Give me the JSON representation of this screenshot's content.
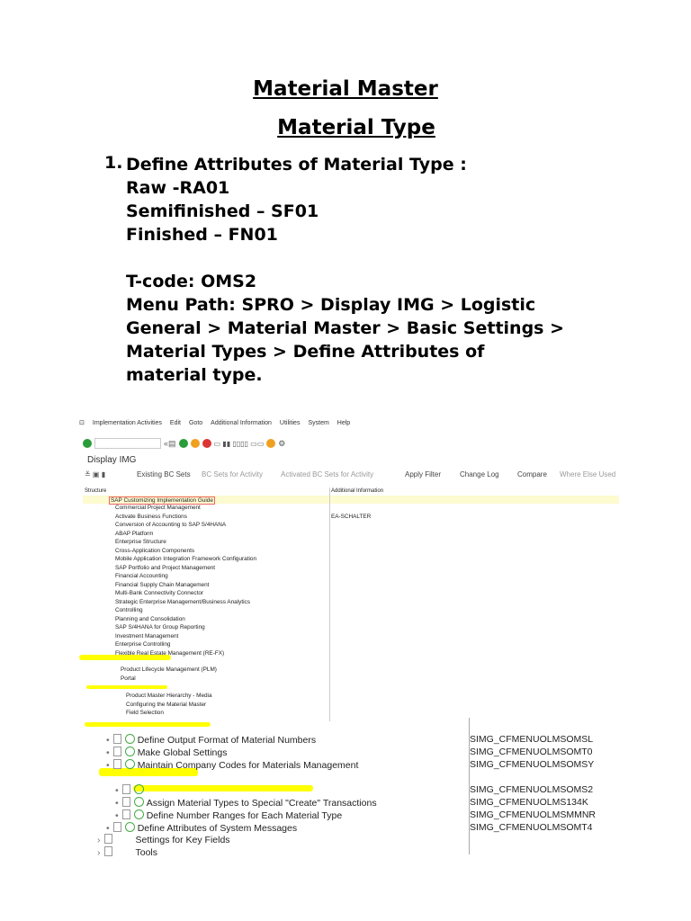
{
  "doc": {
    "title": "Material Master",
    "subtitle": "Material Type",
    "item_number": "1.",
    "lines": [
      "Define Attributes of Material Type :",
      "Raw -RA01",
      "Semifinished – SF01",
      "Finished – FN01",
      "",
      "T-code: OMS2",
      "Menu Path:  SPRO > Display IMG > Logistic",
      "General > Material Master > Basic Settings >",
      "Material Types > Define Attributes of",
      "material type."
    ]
  },
  "sap": {
    "menu": [
      "Implementation Activities",
      "Edit",
      "Goto",
      "Additional Information",
      "Utilities",
      "System",
      "Help"
    ],
    "screen_title": "Display IMG",
    "app_toolbar": [
      "Existing BC Sets",
      "BC Sets for Activity",
      "Activated BC Sets for Activity",
      "Apply Filter",
      "Change Log",
      "Compare",
      "Where Else Used"
    ],
    "columns": [
      "Structure",
      "Additional Information"
    ],
    "root": "SAP Customizing Implementation Guide",
    "tree": [
      "Commercial Project Management",
      "Activate Business Functions",
      "Conversion of Accounting to SAP S/4HANA",
      "ABAP Platform",
      "Enterprise Structure",
      "Cross-Application Components",
      "Mobile Application Integration Framework Configuration",
      "SAP Portfolio and Project Management",
      "Financial Accounting",
      "Financial Supply Chain Management",
      "Multi-Bank Connectivity Connector",
      "Strategic Enterprise Management/Business Analytics",
      "Controlling",
      "Planning and Consolidation",
      "SAP S/4HANA for Group Reporting",
      "Investment Management",
      "Enterprise Controlling",
      "Flexible Real Estate Management (RE-FX)"
    ],
    "tree_info": {
      "1": "EA-SCHALTER"
    },
    "sub1": [
      "Product Lifecycle Management (PLM)",
      "Portal"
    ],
    "sub2": [
      "Product Master Hierarchy - Media",
      "Configuring the Material Master",
      "Field Selection"
    ],
    "basic": [
      {
        "label": "Define Output Format of Material Numbers",
        "code": "SIMG_CFMENUOLMSOMSL"
      },
      {
        "label": "Make Global Settings",
        "code": "SIMG_CFMENUOLMSOMT0"
      },
      {
        "label": "Maintain Company Codes for Materials Management",
        "code": "SIMG_CFMENUOLMSOMSY"
      }
    ],
    "types": [
      {
        "label": "",
        "code": "SIMG_CFMENUOLMSOMS2"
      },
      {
        "label": "Assign Material Types to Special \"Create\" Transactions",
        "code": "SIMG_CFMENUOLMS134K"
      },
      {
        "label": "Define Number Ranges for Each Material Type",
        "code": "SIMG_CFMENUOLMSMMNR"
      }
    ],
    "sysmsg": {
      "label": "Define Attributes of System Messages",
      "code": "SIMG_CFMENUOLMSOMT4"
    },
    "tail": [
      "Settings for Key Fields",
      "Tools"
    ],
    "highlight": "#ffff00"
  }
}
